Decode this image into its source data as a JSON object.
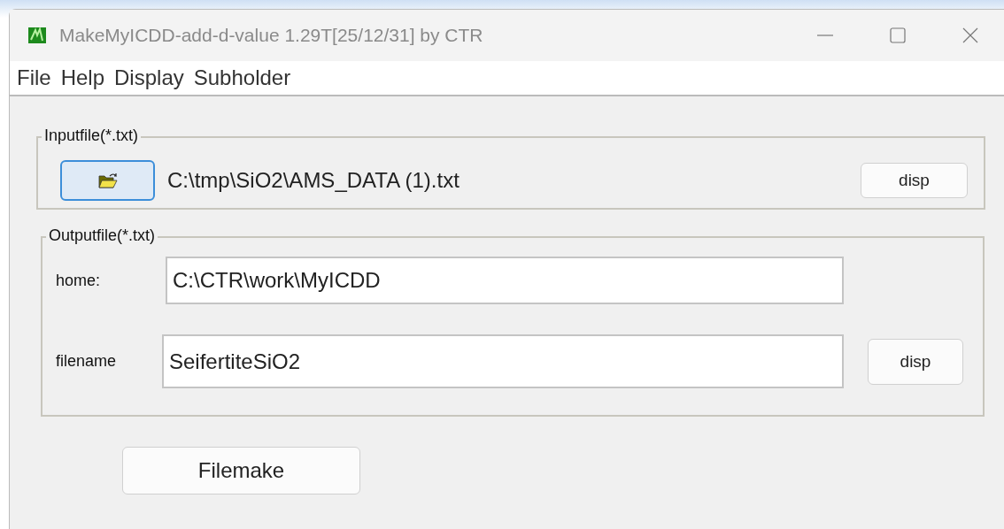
{
  "window": {
    "title": "MakeMyICDD-add-d-value 1.29T[25/12/31] by CTR"
  },
  "menu": [
    "File",
    "Help",
    "Display",
    "Subholder"
  ],
  "input_group": {
    "legend": "Inputfile(*.txt)",
    "path": "C:\\tmp\\SiO2\\AMS_DATA (1).txt",
    "button": "disp"
  },
  "output_group": {
    "legend": "Outputfile(*.txt)",
    "home_label": "home:",
    "home_value": "C:\\CTR\\work\\MyICDD",
    "filename_label": "filename",
    "filename_value": "SeifertiteSiO2",
    "button": "disp"
  },
  "filemake_button": "Filemake"
}
